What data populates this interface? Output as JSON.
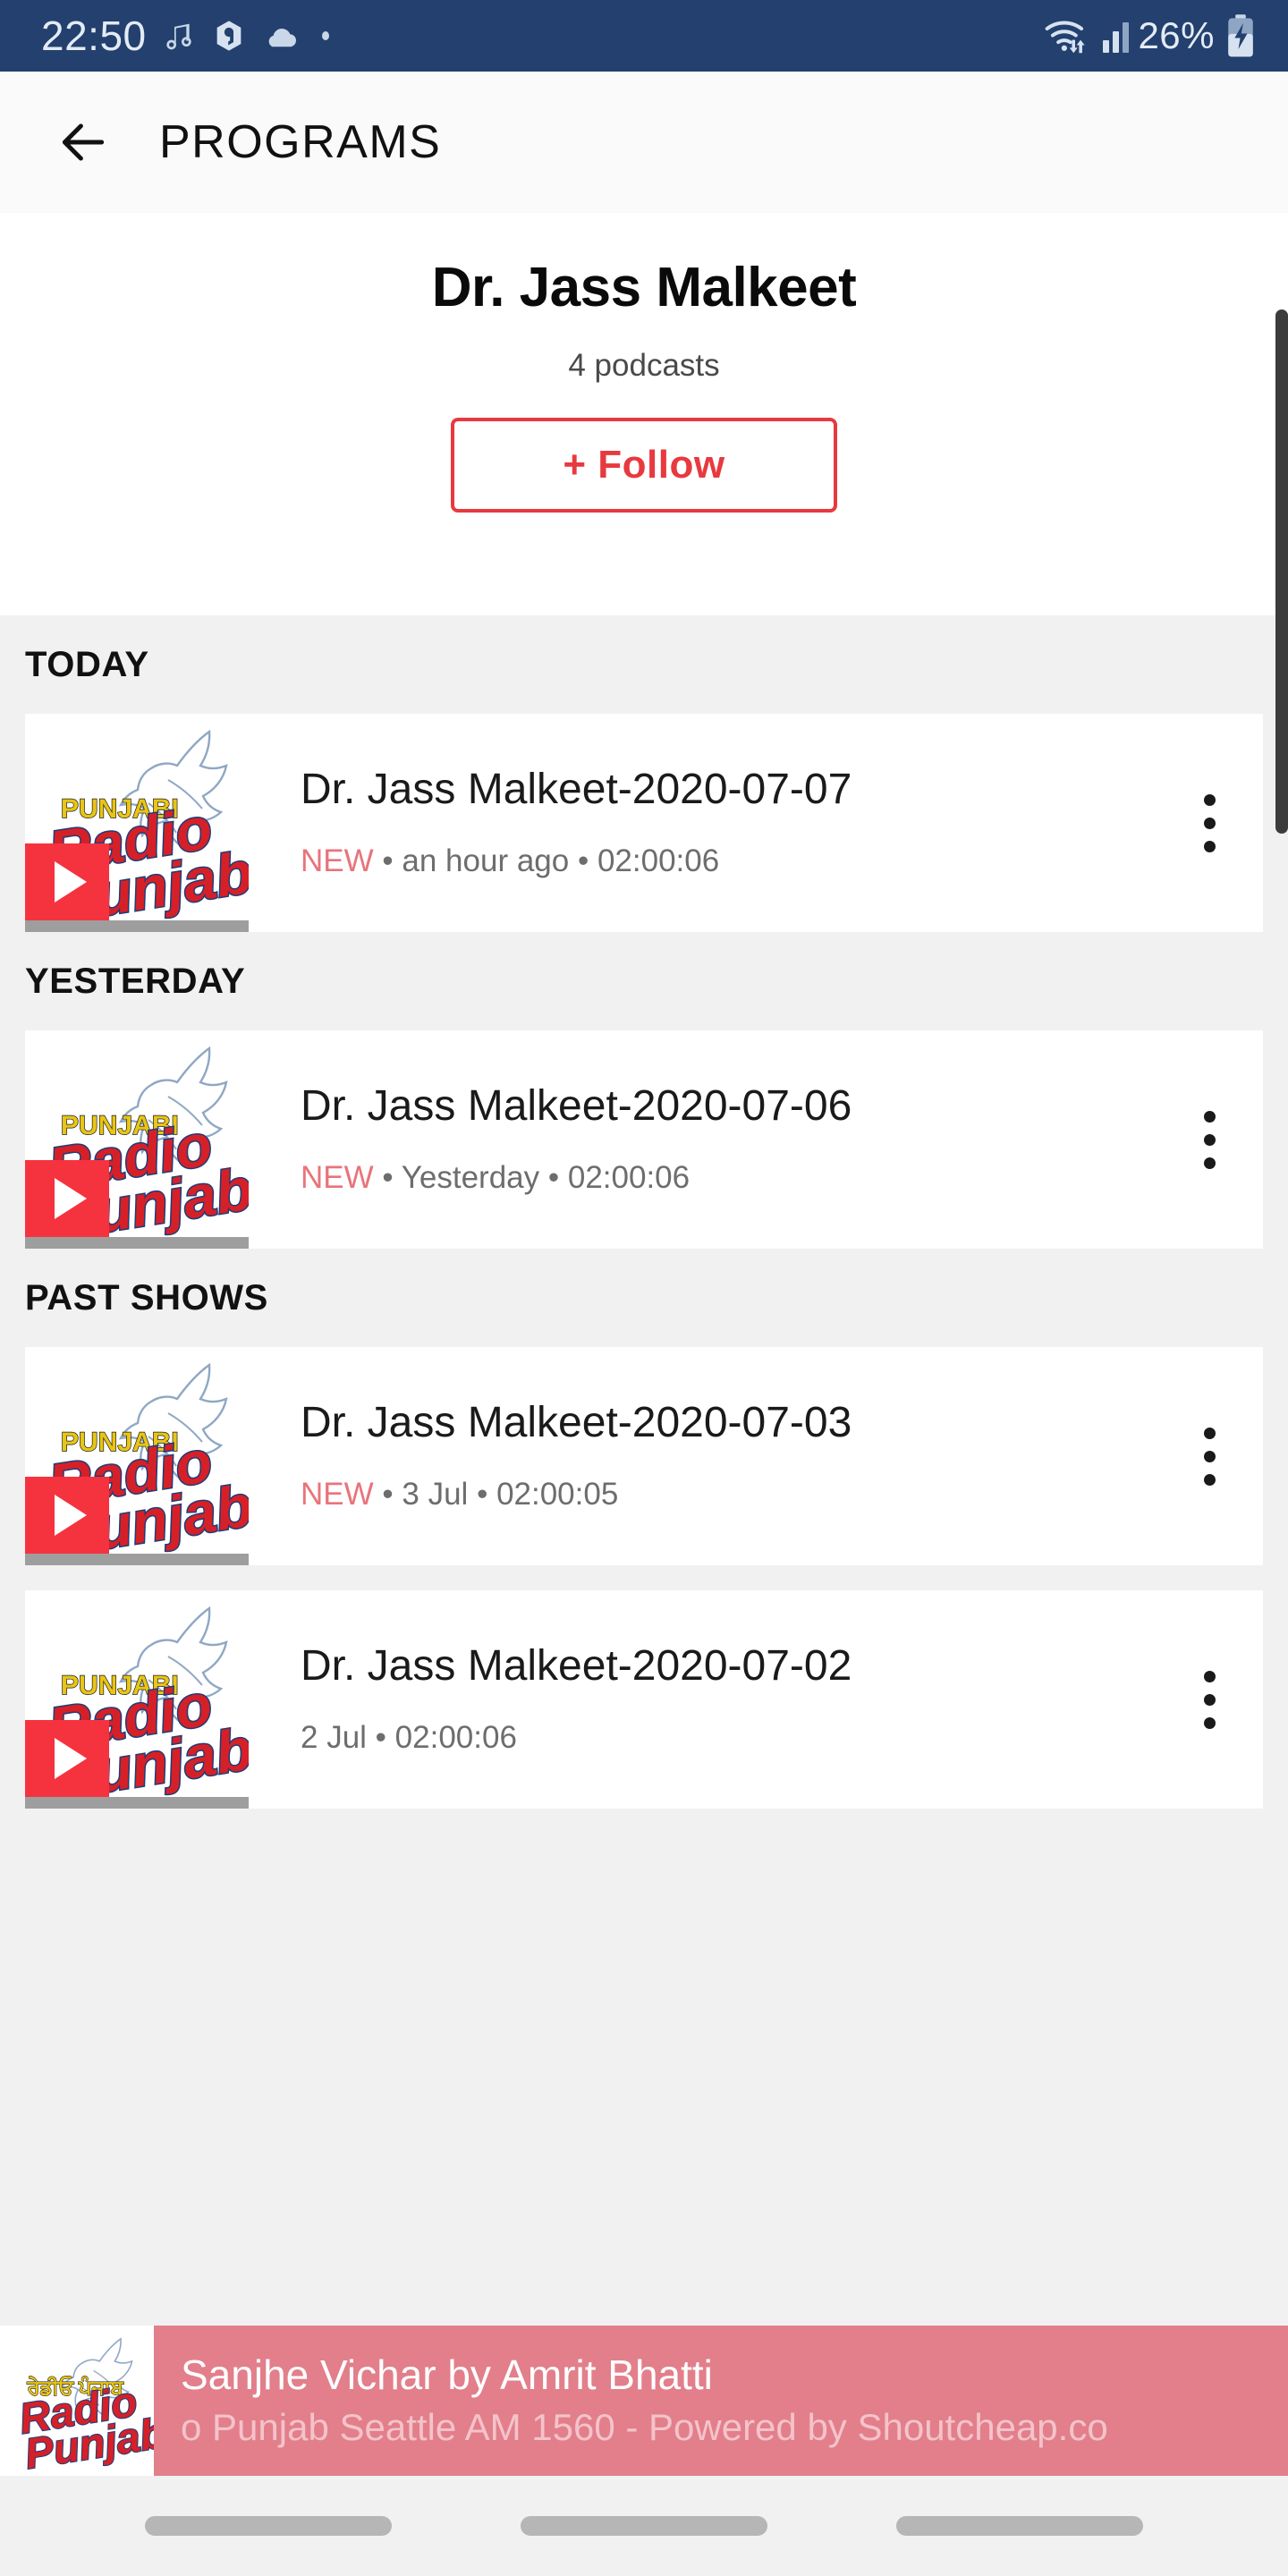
{
  "status_bar": {
    "time": "22:50",
    "battery_percent": "26%",
    "icons": [
      "music-note-icon",
      "app-badge-icon",
      "cloud-icon",
      "dot-icon",
      "wifi-icon",
      "signal-icon",
      "battery-charging-icon"
    ]
  },
  "app_bar": {
    "back_icon": "arrow-left-icon",
    "title": "PROGRAMS"
  },
  "artist": {
    "name": "Dr. Jass Malkeet",
    "podcast_count": "4 podcasts",
    "follow_label": "+ Follow",
    "accent_color": "#E8393F"
  },
  "sections": [
    {
      "label": "TODAY",
      "items": [
        {
          "title": "Dr. Jass Malkeet-2020-07-07",
          "badge": "NEW",
          "date": "an hour ago",
          "duration": "02:00:06",
          "separator": "•"
        }
      ]
    },
    {
      "label": "YESTERDAY",
      "items": [
        {
          "title": "Dr. Jass Malkeet-2020-07-06",
          "badge": "NEW",
          "date": "Yesterday",
          "duration": "02:00:06",
          "separator": "•"
        }
      ]
    },
    {
      "label": "PAST SHOWS",
      "items": [
        {
          "title": "Dr. Jass Malkeet-2020-07-03",
          "badge": "NEW",
          "date": "3 Jul",
          "duration": "02:00:05",
          "separator": "•"
        },
        {
          "title": "Dr. Jass Malkeet-2020-07-02",
          "badge": "",
          "date": "2 Jul",
          "duration": "02:00:06",
          "separator": "•"
        }
      ]
    }
  ],
  "thumbnail_logo": {
    "punjabi_text": "ਰੇਡੀਓ ਪੰਜਾਬ",
    "line1": "Radio",
    "line2": "Punjab",
    "bird_icon": "dove-icon",
    "play_icon": "play-icon"
  },
  "player": {
    "title": "Sanjhe Vichar by Amrit Bhatti",
    "subtitle": "o Punjab Seattle AM 1560 - Powered by Shoutcheap.co",
    "bar_color": "#E27F8B"
  },
  "nav_bar": {
    "pills": [
      "nav-pill-recents",
      "nav-pill-home",
      "nav-pill-back"
    ]
  }
}
